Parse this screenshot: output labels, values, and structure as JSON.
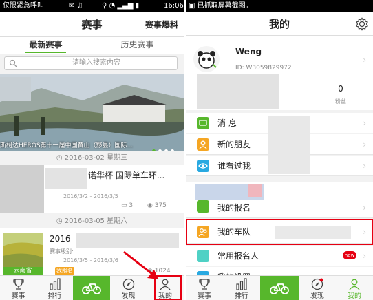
{
  "left": {
    "status": {
      "text": "仅限紧急呼叫",
      "time": "16:06"
    },
    "header": {
      "title": "赛事",
      "action": "赛事爆料"
    },
    "tabs": [
      {
        "label": "最新赛事"
      },
      {
        "label": "历史赛事"
      }
    ],
    "search": {
      "placeholder": "请输入搜索内容"
    },
    "banner": {
      "caption": "斯柯达HEROS第十一届中国黄山（黟县）国际..."
    },
    "events": [
      {
        "date": "2016-03-02  星期三",
        "title": "诺华杯 国际单车环...",
        "date_range": "2016/3/2 - 2016/3/5",
        "comments": "3",
        "views": "375"
      },
      {
        "date": "2016-03-05  星期六",
        "title": "2016",
        "level": "赛事级别:",
        "date_range": "2016/3/5 - 2016/3/6",
        "location": "云南省",
        "signup": "我报名",
        "views": "1024"
      }
    ],
    "nav": [
      {
        "label": "赛事"
      },
      {
        "label": "排行"
      },
      {
        "label": ""
      },
      {
        "label": "发现"
      },
      {
        "label": "我的"
      }
    ]
  },
  "right": {
    "status": {
      "text": "已抓取屏幕截图。"
    },
    "header": {
      "title": "我的"
    },
    "profile": {
      "name": "Weng",
      "id": "ID: W3059829972",
      "fans_count": "0",
      "fans_label": "粉丝"
    },
    "menu": [
      {
        "label": "消 息"
      },
      {
        "label": "新的朋友"
      },
      {
        "label": "谁看过我"
      },
      {
        "label": "我的报名"
      },
      {
        "label": "我的车队"
      },
      {
        "label": "常用报名人",
        "badge": "new"
      },
      {
        "label": "我的设置"
      }
    ],
    "nav": [
      {
        "label": "赛事"
      },
      {
        "label": "排行"
      },
      {
        "label": ""
      },
      {
        "label": "发现"
      },
      {
        "label": "我的"
      }
    ]
  },
  "colors": {
    "accent": "#57b72c",
    "highlight": "#e60012"
  }
}
